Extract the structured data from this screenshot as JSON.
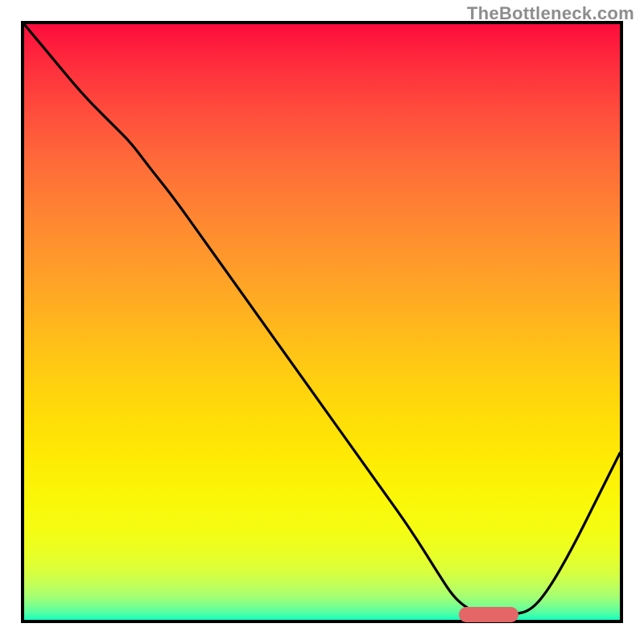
{
  "watermark": "TheBottleneck.com",
  "chart_data": {
    "type": "line",
    "title": "",
    "xlabel": "",
    "ylabel": "",
    "xlim": [
      0,
      100
    ],
    "ylim": [
      0,
      100
    ],
    "background_gradient": {
      "top_color": "#fd0c3c",
      "bottom_color": "#12ffc1",
      "description": "vertical red-to-green spectrum indicating bottleneck severity"
    },
    "series": [
      {
        "name": "bottleneck-curve",
        "x": [
          0,
          5,
          10,
          15,
          18,
          21,
          25,
          30,
          35,
          40,
          45,
          50,
          55,
          60,
          65,
          70,
          72,
          74,
          76,
          78,
          80,
          82,
          85,
          88,
          92,
          96,
          100
        ],
        "values": [
          100,
          94,
          88,
          83,
          80,
          76,
          71,
          64,
          57,
          50,
          43,
          36,
          29,
          22,
          15,
          7,
          4,
          2.2,
          1.2,
          0.8,
          0.7,
          0.9,
          1.5,
          5,
          12,
          20,
          28
        ]
      }
    ],
    "marker": {
      "name": "optimal-range",
      "x_start": 73,
      "x_end": 83,
      "y": 0.9,
      "color": "#e46666"
    },
    "annotations": []
  }
}
